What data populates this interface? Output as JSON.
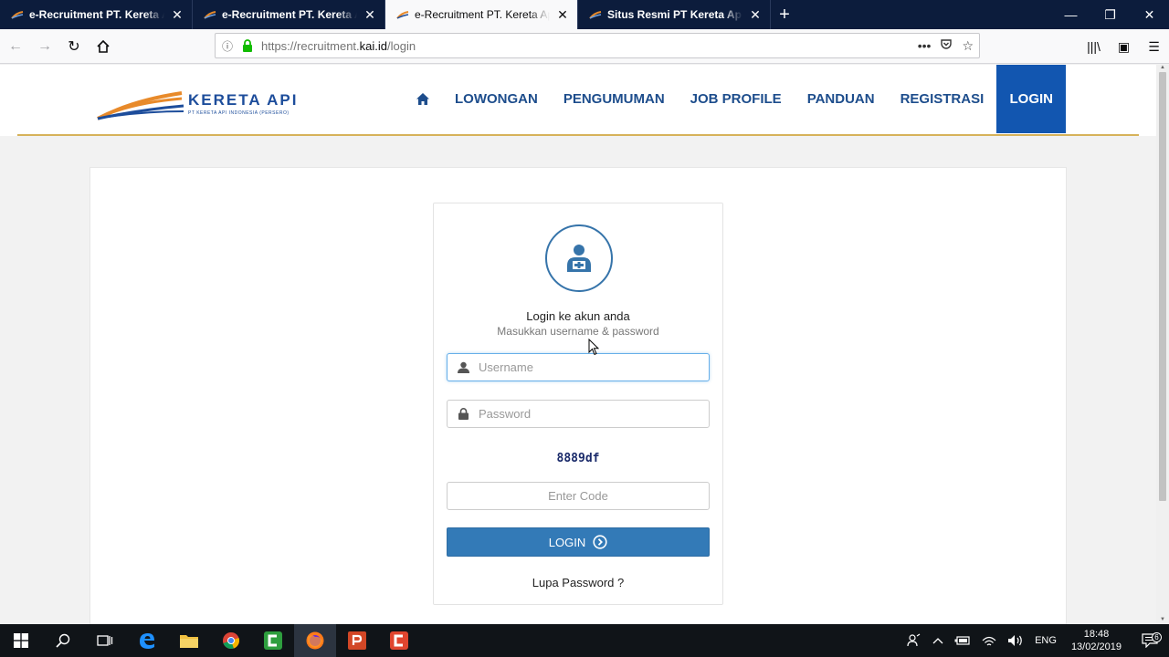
{
  "browser": {
    "tabs": [
      {
        "title": "e-Recruitment PT. Kereta Api Indonesia",
        "active": false
      },
      {
        "title": "e-Recruitment PT. Kereta Api Indonesia",
        "active": false
      },
      {
        "title": "e-Recruitment PT. Kereta Api Indonesia",
        "active": true
      },
      {
        "title": "Situs Resmi PT Kereta Api Indonesia",
        "active": false
      }
    ],
    "new_tab": "+",
    "url_prefix": "https://recruitment.",
    "url_domain": "kai.id",
    "url_path": "/login"
  },
  "site": {
    "logo_brand": "KERETA API",
    "logo_sub": "PT KERETA API INDONESIA (PERSERO)",
    "menu": [
      "LOWONGAN",
      "PENGUMUMAN",
      "JOB PROFILE",
      "PANDUAN",
      "REGISTRASI"
    ],
    "menu_login": "LOGIN",
    "accent": "#1256b0",
    "line_color": "#d6b25a"
  },
  "login": {
    "title": "Login ke akun anda",
    "subtitle": "Masukkan username & password",
    "username_placeholder": "Username",
    "password_placeholder": "Password",
    "captcha": "8889df",
    "code_placeholder": "Enter Code",
    "button": "LOGIN",
    "forgot": "Lupa Password ?"
  },
  "taskbar": {
    "lang": "ENG",
    "time": "18:48",
    "date": "13/02/2019",
    "notif_count": "6"
  }
}
